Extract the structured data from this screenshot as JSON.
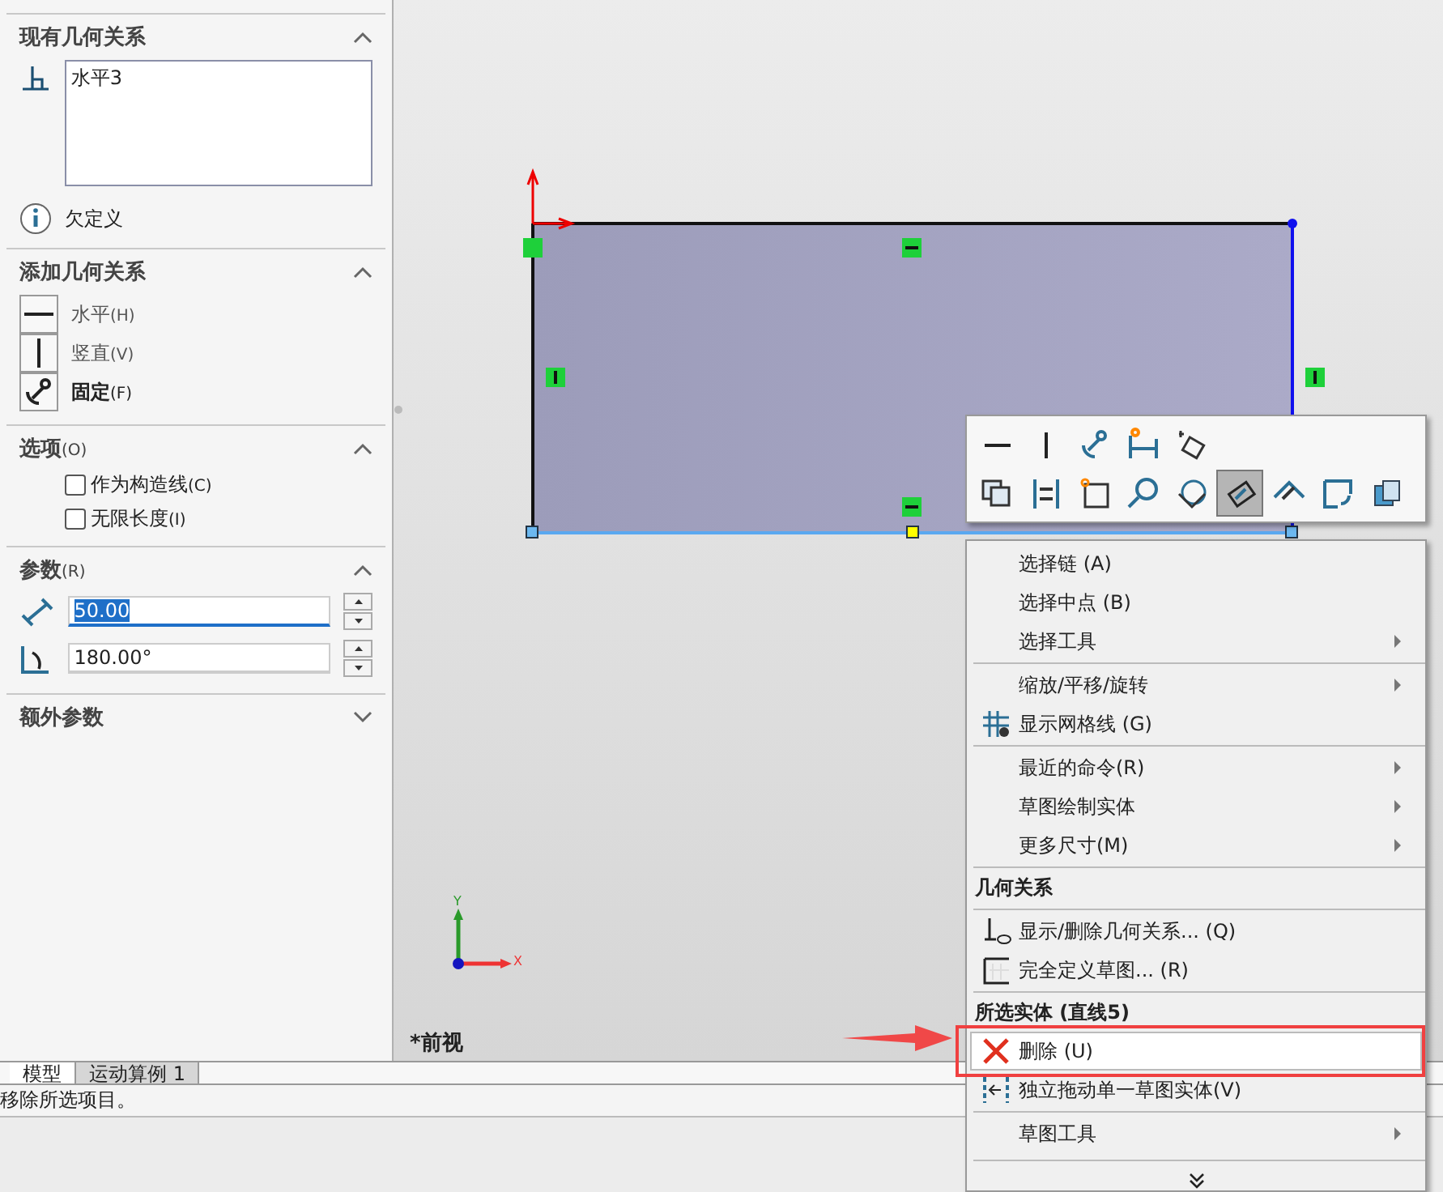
{
  "panel": {
    "sections": [
      {
        "kind": "relations",
        "title": "现有几何关系",
        "expanded": true,
        "items": [
          "水平3"
        ],
        "status": "欠定义"
      },
      {
        "kind": "add",
        "title": "添加几何关系",
        "expanded": true,
        "items": [
          {
            "kind": "horizontal",
            "label": "水平",
            "shortcut": "(H)",
            "emphasized": false
          },
          {
            "kind": "vertical",
            "label": "竖直",
            "shortcut": "(V)",
            "emphasized": false
          },
          {
            "kind": "fix",
            "label": "固定",
            "shortcut": "(F)",
            "emphasized": true
          }
        ]
      },
      {
        "kind": "options",
        "title": "选项",
        "shortcut": "(O)",
        "expanded": true,
        "items": [
          {
            "label": "作为构造线",
            "shortcut": "(C)",
            "checked": false
          },
          {
            "label": "无限长度",
            "shortcut": "(I)",
            "checked": false
          }
        ]
      },
      {
        "kind": "params",
        "title": "参数",
        "shortcut": "(R)",
        "expanded": true,
        "fields": [
          {
            "kind": "length",
            "value": "50.00",
            "text_selected": true
          },
          {
            "kind": "angle",
            "value": "180.00°",
            "text_selected": false
          }
        ]
      },
      {
        "kind": "extra",
        "title": "额外参数",
        "expanded": false
      }
    ]
  },
  "canvas": {
    "view_label": "*前视",
    "axis_labels": [
      "Y",
      "X"
    ]
  },
  "toolbar": {
    "rows": [
      [
        {
          "selected": false
        },
        {
          "selected": false
        },
        {
          "selected": false
        },
        {
          "selected": false
        },
        {
          "selected": false
        }
      ],
      [
        {
          "selected": false
        },
        {
          "selected": false
        },
        {
          "selected": false
        },
        {
          "selected": false
        },
        {
          "selected": false
        },
        {
          "selected": true
        },
        {
          "selected": false
        },
        {
          "selected": false
        },
        {
          "selected": false
        }
      ]
    ]
  },
  "context_menu": {
    "groups": [
      [
        {
          "kind": "plain",
          "label": "选择链 (A)",
          "submenu": false,
          "selected": false
        },
        {
          "kind": "plain",
          "label": "选择中点 (B)",
          "submenu": false,
          "selected": false
        },
        {
          "kind": "plain",
          "label": "选择工具",
          "submenu": true,
          "selected": false
        }
      ],
      [
        {
          "kind": "plain",
          "label": "缩放/平移/旋转",
          "submenu": true,
          "selected": false
        },
        {
          "kind": "grid",
          "label": "显示网格线 (G)",
          "submenu": false,
          "selected": false
        }
      ],
      [
        {
          "kind": "plain",
          "label": "最近的命令(R)",
          "submenu": true,
          "selected": false
        },
        {
          "kind": "plain",
          "label": "草图绘制实体",
          "submenu": true,
          "selected": false
        },
        {
          "kind": "plain",
          "label": "更多尺寸(M)",
          "submenu": true,
          "selected": false
        }
      ],
      [
        {
          "kind": "header",
          "label": "几何关系"
        }
      ],
      [
        {
          "kind": "relations",
          "label": "显示/删除几何关系... (Q)",
          "submenu": false,
          "selected": false
        },
        {
          "kind": "define",
          "label": "完全定义草图... (R)",
          "submenu": false,
          "selected": false
        }
      ],
      [
        {
          "kind": "header",
          "label": "所选实体 (直线5)"
        },
        {
          "kind": "delete",
          "label": "删除 (U)",
          "submenu": false,
          "selected": true
        },
        {
          "kind": "drag",
          "label": "独立拖动单一草图实体(V)",
          "submenu": false,
          "selected": false
        }
      ],
      [
        {
          "kind": "plain",
          "label": "草图工具",
          "submenu": true,
          "selected": false
        }
      ]
    ]
  },
  "bottom_tabs": [
    {
      "label": "模型",
      "selected": true
    },
    {
      "label": "运动算例 1",
      "selected": false
    }
  ],
  "status_bar": "移除所选项目。"
}
